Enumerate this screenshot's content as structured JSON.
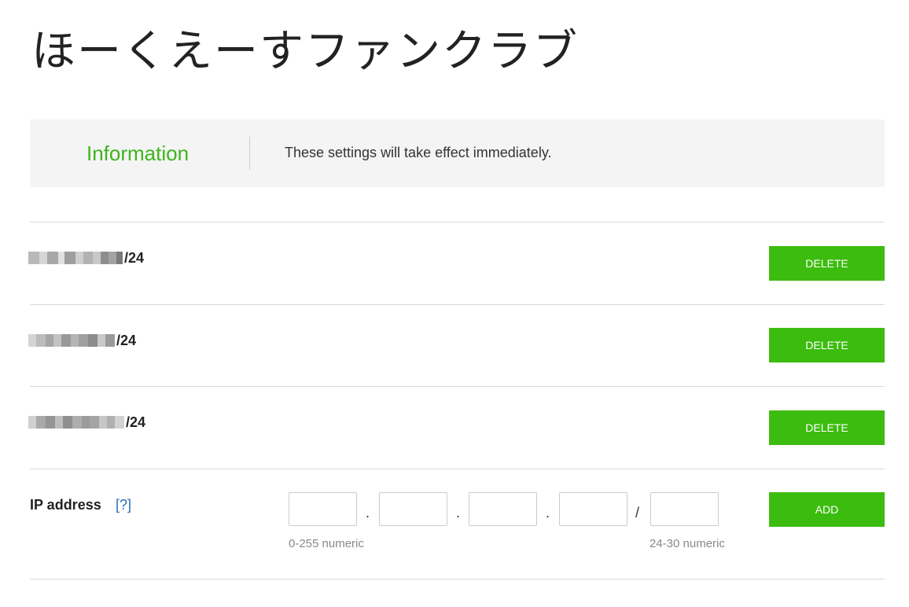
{
  "page": {
    "title": "ほーくえーすファンクラブ"
  },
  "info": {
    "title": "Information",
    "message": "These settings will take effect immediately."
  },
  "entries": [
    {
      "suffix": "/24",
      "delete_label": "DELETE"
    },
    {
      "suffix": "/24",
      "delete_label": "DELETE"
    },
    {
      "suffix": "/24",
      "delete_label": "DELETE"
    }
  ],
  "add_form": {
    "label": "IP address",
    "help_link": "[?]",
    "octet_values": [
      "",
      "",
      "",
      ""
    ],
    "prefix_value": "",
    "separators": [
      ".",
      ".",
      ".",
      "/"
    ],
    "octet_hint": "0-255 numeric",
    "prefix_hint": "24-30 numeric",
    "add_label": "ADD"
  },
  "colors": {
    "accent_green": "#3cbc0f",
    "info_title_green": "#3db51a",
    "help_link_blue": "#2a6fb2"
  }
}
